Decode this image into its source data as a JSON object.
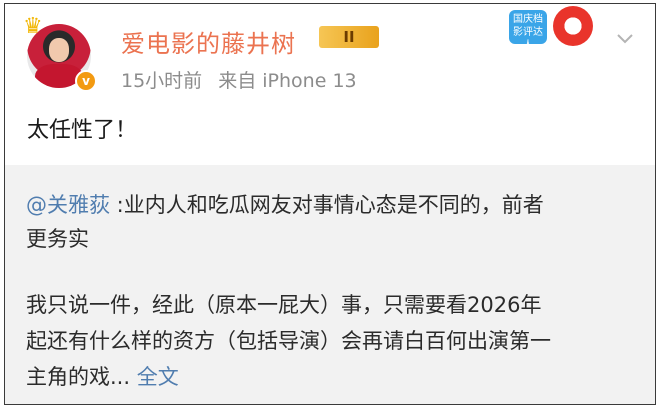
{
  "user": {
    "name": "爱电影的藤井树",
    "level_label": "II",
    "verified_mark": "v",
    "crown_icon": "crown-icon",
    "time": "15小时前",
    "source": "来自 iPhone 13"
  },
  "sticker": {
    "label": "国庆档影评达人"
  },
  "post": {
    "text": "太任性了！"
  },
  "repost": {
    "mention": "@关雅荻",
    "line1": " :业内人和吃瓜网友对事情心态是不同的，前者",
    "line2": "更务实",
    "para2_line1": "我只说一件，经此（原本一屁大）事，只需要看2026年",
    "para2_line2": "起还有什么样的资方（包括导演）会再请白百何出演第一",
    "para2_line3": "主角的戏... ",
    "full_text_link": "全文"
  },
  "colors": {
    "username": "#eb7350",
    "link": "#507daf",
    "repost_bg": "#f2f2f2"
  }
}
